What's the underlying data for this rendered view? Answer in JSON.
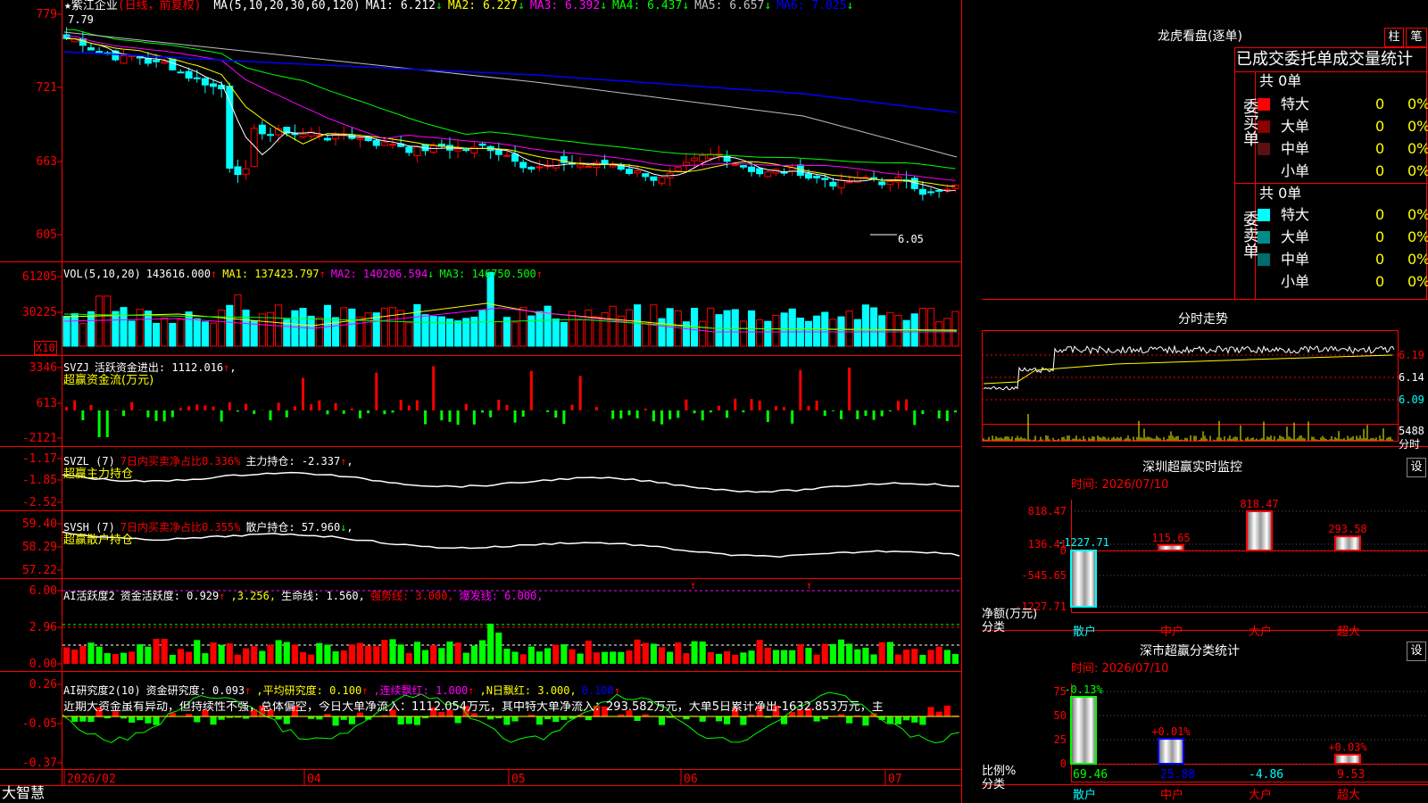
{
  "app": {
    "brand": "大智慧"
  },
  "stock": {
    "star": "★",
    "name": "紫江企业",
    "period": "(日线，前复权)"
  },
  "main_panel": {
    "ma_header": [
      {
        "text": "MA(5,10,20,30,60,120)",
        "color": "#ffffff"
      },
      {
        "text": "MA1: 6.212",
        "color": "#ffffff"
      },
      {
        "text": "↓",
        "color": "#00ff00"
      },
      {
        "text": "MA2: 6.227",
        "color": "#ffff00"
      },
      {
        "text": "↓",
        "color": "#00ff00"
      },
      {
        "text": "MA3: 6.392",
        "color": "#ff00ff"
      },
      {
        "text": "↓",
        "color": "#00ff00"
      },
      {
        "text": "MA4: 6.437",
        "color": "#00ff00"
      },
      {
        "text": "↓",
        "color": "#00ff00"
      },
      {
        "text": "MA5: 6.657",
        "color": "#c0c0c0"
      },
      {
        "text": "↓",
        "color": "#00ff00"
      },
      {
        "text": "MA6: 7.025",
        "color": "#0000ff"
      },
      {
        "text": "↓",
        "color": "#00ff00"
      }
    ],
    "y_labels": [
      "779",
      "721",
      "663",
      "605"
    ],
    "high_label": "7.79",
    "low_label": "6.05"
  },
  "vol_panel": {
    "header": [
      {
        "text": "VOL(5,10,20)",
        "color": "#ffffff"
      },
      {
        "text": "143616.000",
        "color": "#ffffff"
      },
      {
        "text": "↑",
        "color": "#ff0000"
      },
      {
        "text": "MA1: 137423.797",
        "color": "#ffff00"
      },
      {
        "text": "↑",
        "color": "#ff0000"
      },
      {
        "text": "MA2: 140206.594",
        "color": "#ff00ff"
      },
      {
        "text": "↓",
        "color": "#00ff00"
      },
      {
        "text": "MA3: 146750.500",
        "color": "#00ff00"
      },
      {
        "text": "↑",
        "color": "#ff0000"
      }
    ],
    "y_labels": [
      "61205",
      "30225"
    ],
    "unit": "X10"
  },
  "svzj_panel": {
    "header": [
      {
        "text": "SVZJ",
        "color": "#ffffff"
      },
      {
        "text": "活跃资金进出: 1112.016",
        "color": "#ffffff"
      },
      {
        "text": "↑",
        "color": "#ff0000"
      },
      {
        "text": ",",
        "color": "#ffffff"
      }
    ],
    "subtitle": "超赢资金流(万元)",
    "y_labels": [
      "3346",
      "613",
      "-2121"
    ]
  },
  "svzl_panel": {
    "header": [
      {
        "text": "SVZL (7)",
        "color": "#ffffff"
      },
      {
        "text": "7日内买卖净占比0.336%",
        "color": "#ff0000"
      },
      {
        "text": "主力持仓: -2.337",
        "color": "#ffffff"
      },
      {
        "text": "↑",
        "color": "#ff0000"
      },
      {
        "text": ",",
        "color": "#ffffff"
      }
    ],
    "subtitle": "超赢主力持仓",
    "y_labels": [
      "-1.17",
      "-1.85",
      "-2.52"
    ]
  },
  "svsh_panel": {
    "header": [
      {
        "text": "SVSH (7)",
        "color": "#ffffff"
      },
      {
        "text": "7日内买卖净占比0.355%",
        "color": "#ff0000"
      },
      {
        "text": "散户持仓: 57.960",
        "color": "#ffffff"
      },
      {
        "text": "↓",
        "color": "#00ff00"
      },
      {
        "text": ",",
        "color": "#ffffff"
      }
    ],
    "subtitle": "超赢散户持仓",
    "y_labels": [
      "59.40",
      "58.29",
      "57.22"
    ]
  },
  "ai_active_panel": {
    "header": [
      {
        "text": "AI活跃度2",
        "color": "#ffffff"
      },
      {
        "text": "资金活跃度: 0.929",
        "color": "#ffffff"
      },
      {
        "text": "↑",
        "color": "#ff0000"
      },
      {
        "text": ",3.256,",
        "color": "#ffff00"
      },
      {
        "text": "生命线: 1.560,",
        "color": "#ffffff"
      },
      {
        "text": "强势线: 3.000,",
        "color": "#ff0000"
      },
      {
        "text": "爆发线: 6.000,",
        "color": "#ff00ff"
      }
    ],
    "y_labels": [
      "6.00",
      "2.96",
      "0.00"
    ]
  },
  "ai_research_panel": {
    "header": [
      {
        "text": "AI研究度2(10)",
        "color": "#ffffff"
      },
      {
        "text": "资金研究度: 0.093",
        "color": "#ffffff"
      },
      {
        "text": "↑",
        "color": "#ff0000"
      },
      {
        "text": ",平均研究度: 0.100",
        "color": "#ffff00"
      },
      {
        "text": "↑",
        "color": "#ff0000"
      },
      {
        "text": ",连续飘红: 1.000",
        "color": "#ff00ff"
      },
      {
        "text": "↑",
        "color": "#ff0000"
      },
      {
        "text": ",N日飘红: 3.000,",
        "color": "#ffff00"
      },
      {
        "text": "0.100",
        "color": "#0000ff"
      },
      {
        "text": "↑",
        "color": "#ff0000"
      }
    ],
    "comment": "近期大资金虽有异动，但持续性不强，总体偏空，今日大单净流入：1112.054万元，其中特大单净流入：293.582万元，大单5日累计净出-1632.853万元，主",
    "y_labels": [
      "0.26",
      "-0.05",
      "-0.37"
    ]
  },
  "date_axis": [
    "2026/02",
    "04",
    "05",
    "06",
    "07"
  ],
  "lhb": {
    "title": "龙虎看盘(逐单)",
    "btn_column": "柱",
    "btn_pen": "笔",
    "heading": "已成交委托单成交量统计",
    "buy_label": "委买单",
    "sell_label": "委卖单",
    "buy_total": "共 0单",
    "sell_total": "共 0单",
    "buy_rows": [
      {
        "label": "特大",
        "count": "0",
        "pct": "0%",
        "color": "#ff0000"
      },
      {
        "label": "大单",
        "count": "0",
        "pct": "0%",
        "color": "#8b0000"
      },
      {
        "label": "中单",
        "count": "0",
        "pct": "0%",
        "color": "#5a1010"
      },
      {
        "label": "小单",
        "count": "0",
        "pct": "0%",
        "color": ""
      }
    ],
    "sell_rows": [
      {
        "label": "特大",
        "count": "0",
        "pct": "0%",
        "color": "#00ffff"
      },
      {
        "label": "大单",
        "count": "0",
        "pct": "0%",
        "color": "#008b8b"
      },
      {
        "label": "中单",
        "count": "0",
        "pct": "0%",
        "color": "#006b6b"
      },
      {
        "label": "小单",
        "count": "0",
        "pct": "0%",
        "color": ""
      }
    ]
  },
  "intraday": {
    "title": "分时走势",
    "prices": [
      "6.19",
      "6.14",
      "6.09"
    ],
    "volume": "5488",
    "vol_unit": "分时"
  },
  "sz_monitor": {
    "title": "深圳超赢实时监控",
    "settings": "设",
    "time": "时间: 2026/07/10",
    "y_labels": [
      "818.47",
      "136.41",
      "0",
      "-545.65",
      "-1227.71"
    ],
    "y_title_1": "净额(万元)",
    "y_title_2": "分类",
    "chart_data": {
      "type": "bar",
      "categories": [
        "散户",
        "中户",
        "大户",
        "超大"
      ],
      "values": [
        -1227.71,
        115.65,
        818.47,
        293.58
      ],
      "value_labels": [
        "-1227.71",
        "115.65",
        "818.47",
        "293.58"
      ],
      "ylim": [
        -1227.71,
        818.47
      ]
    }
  },
  "sz_class": {
    "title": "深市超赢分类统计",
    "settings": "设",
    "time": "时间: 2026/07/10",
    "y_labels": [
      "75",
      "50",
      "25",
      "0"
    ],
    "y_title_1": "比例%",
    "y_title_2": "分类",
    "chart_data": {
      "type": "bar",
      "categories": [
        "散户",
        "中户",
        "大户",
        "超大"
      ],
      "values": [
        69.46,
        25.88,
        -4.86,
        9.53
      ],
      "value_labels": [
        "69.46",
        "25.88",
        "-4.86",
        "9.53"
      ],
      "change_labels": [
        "-0.13%",
        "+0.01%",
        "",
        "+0.03%"
      ],
      "ylim": [
        0,
        75
      ]
    }
  }
}
